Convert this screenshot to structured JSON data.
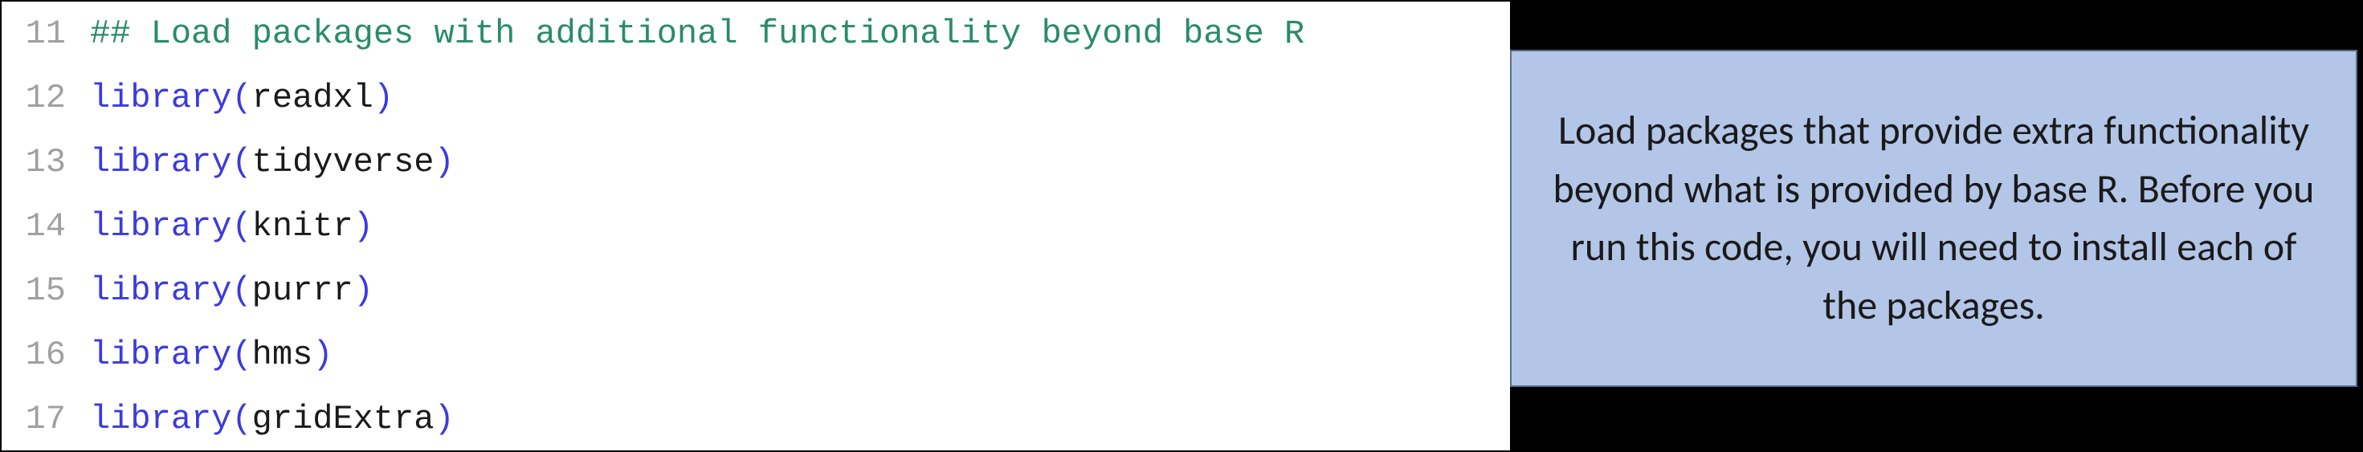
{
  "code": {
    "lines": [
      {
        "num": "11",
        "type": "comment",
        "text": "## Load packages with additional functionality beyond base R"
      },
      {
        "num": "12",
        "type": "call",
        "fn": "library",
        "arg": "readxl"
      },
      {
        "num": "13",
        "type": "call",
        "fn": "library",
        "arg": "tidyverse"
      },
      {
        "num": "14",
        "type": "call",
        "fn": "library",
        "arg": "knitr"
      },
      {
        "num": "15",
        "type": "call",
        "fn": "library",
        "arg": "purrr"
      },
      {
        "num": "16",
        "type": "call",
        "fn": "library",
        "arg": "hms"
      },
      {
        "num": "17",
        "type": "call",
        "fn": "library",
        "arg": "gridExtra"
      }
    ]
  },
  "callout": {
    "text": "Load packages that provide extra functionality beyond what is provided by base R. Before you run this code, you will need to install each of the packages."
  }
}
